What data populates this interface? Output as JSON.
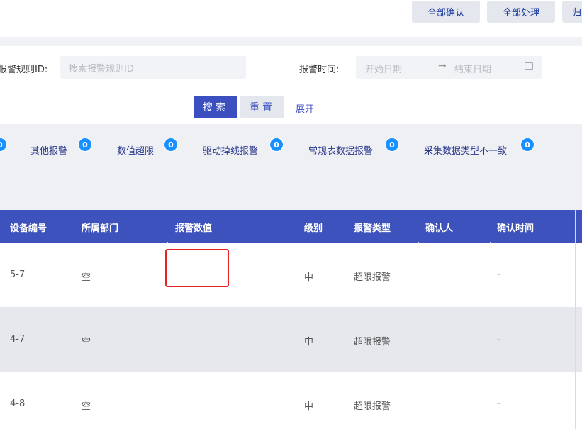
{
  "toolbar": {
    "confirm_all": "全部确认",
    "handle_all": "全部处理",
    "archive": "归"
  },
  "search": {
    "rule_id_label": "报警规则ID:",
    "rule_id_placeholder": "搜索报警规则ID",
    "time_label": "报警时间:",
    "start_placeholder": "开始日期",
    "arrow": "→",
    "end_placeholder": "结束日期",
    "search_btn": "搜索",
    "reset_btn": "重置",
    "expand_link": "展开"
  },
  "categories": [
    {
      "label": "",
      "count": "0"
    },
    {
      "label": "其他报警",
      "count": "0"
    },
    {
      "label": "数值超限",
      "count": "0"
    },
    {
      "label": "驱动掉线报警",
      "count": "0"
    },
    {
      "label": "常规表数据报警",
      "count": "0"
    },
    {
      "label": "采集数据类型不一致",
      "count": "0"
    }
  ],
  "table": {
    "columns": [
      "设备编号",
      "所属部门",
      "报警数值",
      "级别",
      "报警类型",
      "确认人",
      "确认时间"
    ],
    "rows": [
      {
        "device": "5-7",
        "dept": "空",
        "value": "",
        "level": "中",
        "type": "超限报警",
        "confirmer": "",
        "time": "-"
      },
      {
        "device": "4-7",
        "dept": "空",
        "value": "",
        "level": "中",
        "type": "超限报警",
        "confirmer": "",
        "time": "-"
      },
      {
        "device": "4-8",
        "dept": "空",
        "value": "",
        "level": "中",
        "type": "超限报警",
        "confirmer": "",
        "time": "-"
      }
    ]
  },
  "colors": {
    "primary": "#3b4fc0",
    "header_bg": "#3e52bd",
    "badge": "#1890ff",
    "highlight": "#e62424"
  }
}
